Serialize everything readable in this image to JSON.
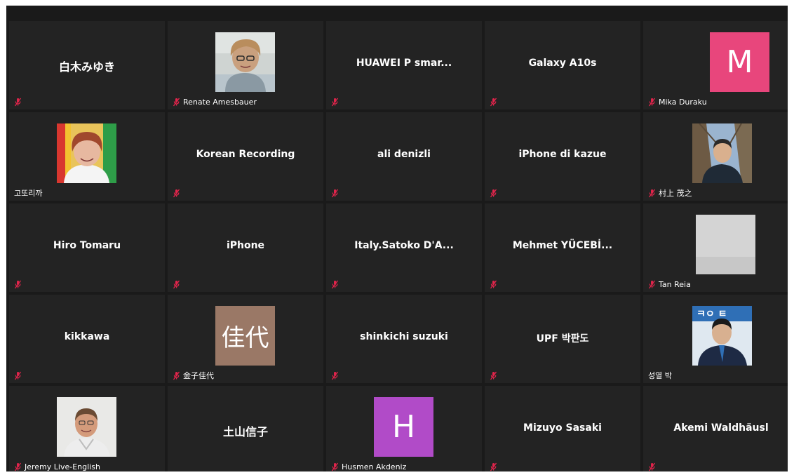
{
  "colors": {
    "gallery_bg": "#1a1a1a",
    "tile_bg": "#232323",
    "muted_icon": "#e0244b",
    "text": "#ffffff",
    "avatar_m": "#e8467c",
    "avatar_h": "#b14bc8",
    "avatar_kanji": "#9a7866"
  },
  "participants": [
    {
      "center_name": "白木みゆき",
      "footer_name": "",
      "muted": true
    },
    {
      "center_name": "",
      "footer_name": "Renate Amesbauer",
      "muted": true,
      "media": "photo"
    },
    {
      "center_name": "HUAWEI P smar...",
      "footer_name": "",
      "muted": true
    },
    {
      "center_name": "Galaxy A10s",
      "footer_name": "",
      "muted": true
    },
    {
      "center_name": "",
      "footer_name": "Mika Duraku",
      "muted": true,
      "media": "avatar",
      "avatar_text": "M"
    },
    {
      "center_name": "",
      "footer_name": "고또리까",
      "muted": false,
      "media": "photo"
    },
    {
      "center_name": "Korean Recording",
      "footer_name": "",
      "muted": true
    },
    {
      "center_name": "ali denizli",
      "footer_name": "",
      "muted": true
    },
    {
      "center_name": "iPhone di kazue",
      "footer_name": "",
      "muted": true
    },
    {
      "center_name": "",
      "footer_name": "村上 茂之",
      "muted": true,
      "media": "photo"
    },
    {
      "center_name": "Hiro Tomaru",
      "footer_name": "",
      "muted": true
    },
    {
      "center_name": "iPhone",
      "footer_name": "",
      "muted": true
    },
    {
      "center_name": "Italy.Satoko  D'A...",
      "footer_name": "",
      "muted": true
    },
    {
      "center_name": "Mehmet  YÜCEBİ...",
      "footer_name": "",
      "muted": true
    },
    {
      "center_name": "",
      "footer_name": "Tan Reia",
      "muted": true,
      "media": "photo"
    },
    {
      "center_name": "kikkawa",
      "footer_name": "",
      "muted": true
    },
    {
      "center_name": "",
      "footer_name": "金子佳代",
      "muted": true,
      "media": "avatar",
      "avatar_text": "佳代"
    },
    {
      "center_name": "shinkichi suzuki",
      "footer_name": "",
      "muted": true
    },
    {
      "center_name": "UPF 박판도",
      "footer_name": "",
      "muted": true
    },
    {
      "center_name": "",
      "footer_name": "성열 박",
      "muted": false,
      "media": "photo"
    },
    {
      "center_name": "",
      "footer_name": "Jeremy Live-English",
      "muted": true,
      "media": "photo"
    },
    {
      "center_name": "土山信子",
      "footer_name": "",
      "muted": false
    },
    {
      "center_name": "",
      "footer_name": "Husmen Akdeniz",
      "muted": true,
      "media": "avatar",
      "avatar_text": "H"
    },
    {
      "center_name": "Mizuyo Sasaki",
      "footer_name": "",
      "muted": true
    },
    {
      "center_name": "Akemi Waldhäusl",
      "footer_name": "",
      "muted": true
    }
  ]
}
